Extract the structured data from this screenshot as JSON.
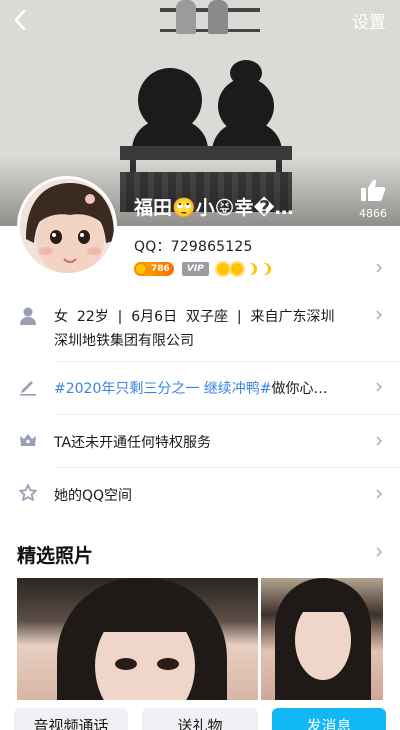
{
  "header": {
    "settings_label": "设置",
    "nickname": "福田🙄小😝幸�…",
    "like_count": "4866"
  },
  "profile": {
    "qq_line": "QQ：729865125",
    "level_number": "786",
    "vip_label": "VIP"
  },
  "info_rows": {
    "basic": [
      "女",
      "22岁",
      "6月6日",
      "双子座",
      "来自广东深圳"
    ],
    "company": "深圳地铁集团有限公司",
    "topic": "#2020年只剩三分之一 继续冲鸭#",
    "topic_suffix": "做你心…",
    "privilege": "TA还未开通任何特权服务",
    "space": "她的QQ空间"
  },
  "photos": {
    "section_title": "精选照片"
  },
  "actions": {
    "video_label": "音视频通话",
    "gift_label": "送礼物",
    "message_label": "发消息"
  },
  "colors": {
    "accent": "#12b7f5",
    "topic": "#3b82e6",
    "icon": "#9a9fb5"
  }
}
